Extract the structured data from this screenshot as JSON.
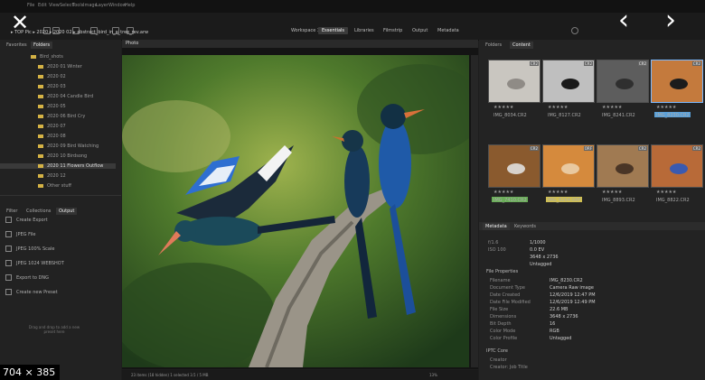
{
  "menu": [
    "File",
    "Edit",
    "View",
    "Select",
    "Tools",
    "Image",
    "Layer",
    "Window",
    "Help"
  ],
  "workspace_tabs": [
    {
      "label": "Workspace 3",
      "active": false
    },
    {
      "label": "Essentials",
      "active": true
    },
    {
      "label": "Libraries",
      "active": false
    },
    {
      "label": "Filmstrip",
      "active": false
    },
    {
      "label": "Output",
      "active": false
    },
    {
      "label": "Metadata",
      "active": false
    }
  ],
  "path": "▸ TOP Pic ▸ 2020 ▸ 2020 02 ▸ abstract_bird_in_a_tree_rev.arw",
  "left_panel": {
    "tabs": [
      "Favorites",
      "Folders"
    ],
    "folders": [
      "Bird_shots",
      "2020 01 Winter",
      "2020 02",
      "2020 03",
      "2020 04 Candle Bird",
      "2020 05",
      "2020 06 Bird Cry",
      "2020 07",
      "2020 08",
      "2020 09 Bird Watching",
      "2020 10 Birdsong",
      "2020 11 Flowers Outflow",
      "2020 12",
      "Other stuff"
    ],
    "selected_folder_index": 11,
    "bottom_tabs": [
      "Filter",
      "Collections",
      "Output"
    ],
    "output_items": [
      "Create Export",
      "JPEG File",
      "JPEG 100% Scale",
      "JPEG 1024 WEBSHOT",
      "Export to DNG",
      "Create new Preset"
    ],
    "hint_text": "Drag and drop to add a new preset here"
  },
  "center": {
    "header_label": "Photo",
    "status_text": "23 items (18 hidden) 1 selected  3.5 / 5 MB",
    "zoom": "13%"
  },
  "right_panel": {
    "tabs": [
      "Folders",
      "Content"
    ],
    "thumbnails": [
      {
        "name": "IMG_8034.CR2",
        "badge": "CR2",
        "rating": "★★★★★",
        "label_color": null,
        "selected": false,
        "art": "snow"
      },
      {
        "name": "IMG_8127.CR2",
        "badge": "CR2",
        "rating": "★★★★★",
        "label_color": null,
        "selected": false,
        "art": "darkbird"
      },
      {
        "name": "IMG_8241.CR2",
        "badge": "CR2",
        "rating": "★★★★★",
        "label_color": null,
        "selected": false,
        "art": "gray"
      },
      {
        "name": "IMG_8230.CR2",
        "badge": "CR2",
        "rating": "★★★★★",
        "label_color": "#5aa0d8",
        "selected": true,
        "art": "redbird"
      },
      {
        "name": "IMG_7410.CR2",
        "badge": "CR2",
        "rating": "★★★★★",
        "label_color": "#6aae58",
        "selected": false,
        "art": "brown"
      },
      {
        "name": "IMG_8264.ORF",
        "badge": "ORF",
        "rating": "★★★★★",
        "label_color": "#d0c052",
        "selected": false,
        "art": "orange"
      },
      {
        "name": "IMG_8893.CR2",
        "badge": "CR2",
        "rating": "★★★★★",
        "label_color": null,
        "selected": false,
        "art": "tan"
      },
      {
        "name": "IMG_8822.CR2",
        "badge": "CR2",
        "rating": "★★★★★",
        "label_color": null,
        "selected": false,
        "art": "redbird2"
      }
    ],
    "meta_tabs": [
      "Metadata",
      "Keywords"
    ],
    "summary": [
      {
        "k": "f/1.6",
        "v": "1/1000"
      },
      {
        "k": "ISO 100",
        "v": "0.0 EV"
      },
      {
        "k": "",
        "v": "3648 x 2736"
      },
      {
        "k": "",
        "v": "Untagged"
      }
    ],
    "file_properties_heading": "File Properties",
    "properties": [
      {
        "k": "Filename",
        "v": "IMG_8230.CR2"
      },
      {
        "k": "Document Type",
        "v": "Camera Raw image"
      },
      {
        "k": "Date Created",
        "v": "12/6/2019 12:47 PM"
      },
      {
        "k": "Date File Modified",
        "v": "12/6/2019 12:49 PM"
      },
      {
        "k": "File Size",
        "v": "22.6 MB"
      },
      {
        "k": "Dimensions",
        "v": "3648 x 2736"
      },
      {
        "k": "Bit Depth",
        "v": "16"
      },
      {
        "k": "Color Mode",
        "v": "RGB"
      },
      {
        "k": "Color Profile",
        "v": "Untagged"
      }
    ],
    "iptc_heading": "IPTC Core",
    "iptc": [
      {
        "k": "Creator",
        "v": ""
      },
      {
        "k": "Creator: Job Title",
        "v": ""
      }
    ]
  },
  "size_badge": "704 × 385",
  "icons": [
    "close-icon",
    "back-arrow-icon",
    "forward-arrow-icon",
    "folder-icon",
    "star-icon"
  ]
}
